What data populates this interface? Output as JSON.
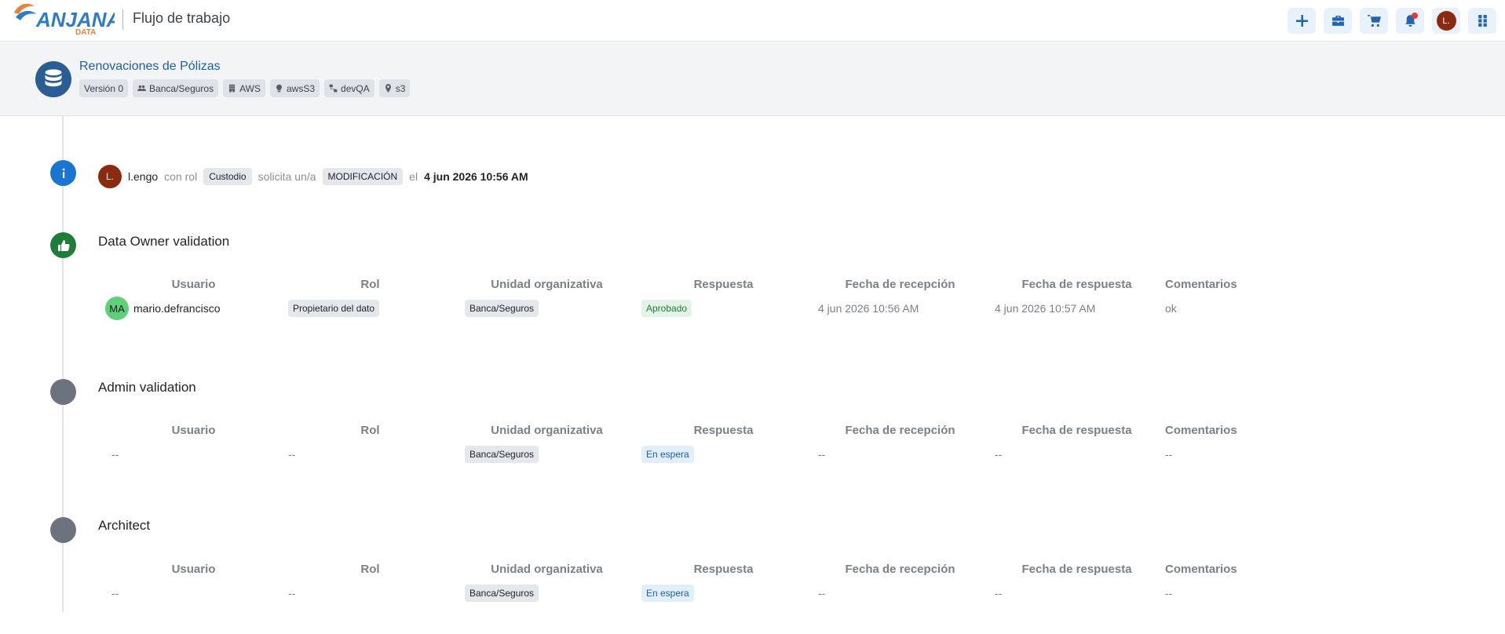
{
  "header": {
    "logo_text": "ANJANA",
    "logo_sub": "DATA",
    "app_title": "Flujo de trabajo",
    "user_initials": "L."
  },
  "asset": {
    "name": "Renovaciones de Pólizas",
    "chips": [
      {
        "icon": "version",
        "label": "Versión 0"
      },
      {
        "icon": "users-icon",
        "label": "Banca/Seguros"
      },
      {
        "icon": "building-icon",
        "label": "AWS"
      },
      {
        "icon": "bulb-icon",
        "label": "awsS3"
      },
      {
        "icon": "network-icon",
        "label": "devQA"
      },
      {
        "icon": "location-icon",
        "label": "s3"
      }
    ]
  },
  "request": {
    "initials": "L.",
    "user": "l.engo",
    "with_role": "con rol",
    "role": "Custodio",
    "requests": "solicita un/a",
    "type": "MODIFICACIÓN",
    "on": "el",
    "date": "4 jun 2026 10:56 AM"
  },
  "columns": [
    "Usuario",
    "Rol",
    "Unidad organizativa",
    "Respuesta",
    "Fecha de recepción",
    "Fecha de respuesta",
    "Comentarios"
  ],
  "stages": [
    {
      "title": "Data Owner validation",
      "row": {
        "initials": "MA",
        "user": "mario.defrancisco",
        "role": "Propietario del dato",
        "unit": "Banca/Seguros",
        "response": "Aprobado",
        "received": "4 jun 2026 10:56 AM",
        "responded": "4 jun 2026 10:57 AM",
        "comment": "ok"
      }
    },
    {
      "title": "Admin validation",
      "row": {
        "user": "--",
        "role": "--",
        "unit": "Banca/Seguros",
        "response": "En espera",
        "received": "--",
        "responded": "--",
        "comment": "--"
      }
    },
    {
      "title": "Architect",
      "row": {
        "user": "--",
        "role": "--",
        "unit": "Banca/Seguros",
        "response": "En espera",
        "received": "--",
        "responded": "--",
        "comment": "--"
      }
    }
  ],
  "colors": {
    "primary": "#1d5fb0",
    "approved": "#1f7d3a",
    "pending_node": "#6c737e"
  }
}
